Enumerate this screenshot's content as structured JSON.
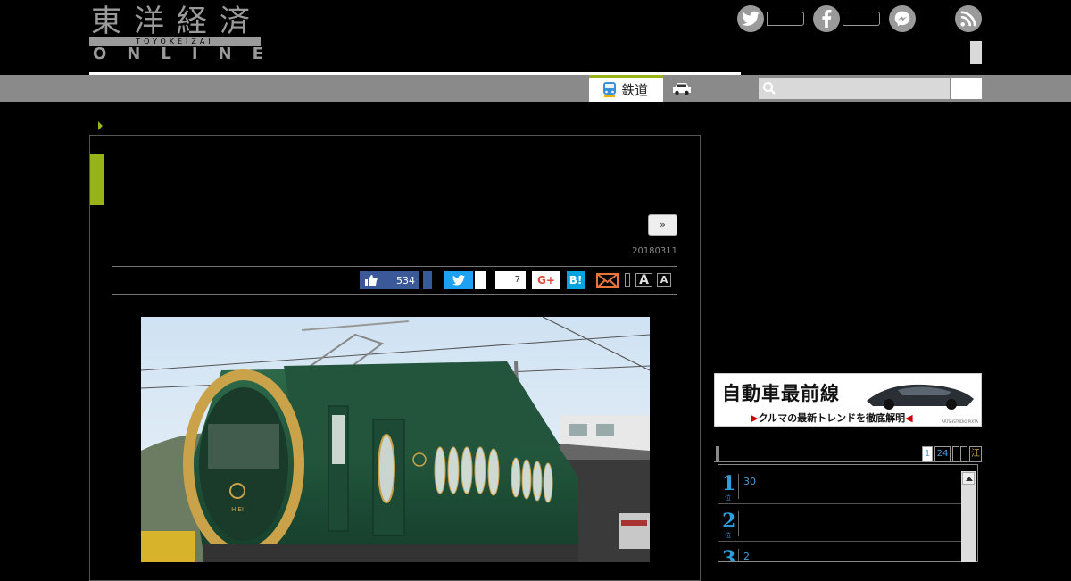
{
  "header": {
    "logo_kanji": "東洋経済",
    "logo_sub": "TOYOKEIZAI",
    "logo_online": "ONLINE",
    "social": [
      "twitter-icon",
      "facebook-icon",
      "messenger-icon",
      "rss-icon"
    ]
  },
  "nav": {
    "active_tab": "鉄道",
    "search": {
      "placeholder": ""
    }
  },
  "article": {
    "next_label": "»",
    "date": "20180311",
    "share": {
      "facebook_count": "534",
      "pocket_count": "7",
      "google_plus_label": "G+",
      "hatena_label": "B!"
    },
    "font_buttons": [
      "A",
      "A"
    ]
  },
  "sidebar": {
    "banner": {
      "title": "自動車最前線",
      "subtitle": "クルマの最新トレンドを徹底解明",
      "credit": "ARTSHSTUDIO PIXTA"
    },
    "ranking": {
      "tabs": [
        "1",
        "24",
        "",
        "",
        "江"
      ],
      "items": [
        {
          "rank": "1",
          "unit": "位",
          "text": "30"
        },
        {
          "rank": "2",
          "unit": "位",
          "text": ""
        },
        {
          "rank": "3",
          "unit": "位",
          "text": "2"
        }
      ]
    }
  },
  "colors": {
    "accent": "#96b318",
    "navbar": "#8a8a8a",
    "rank_blue": "#2d9fdd",
    "facebook": "#3b5998",
    "twitter": "#1da1f2",
    "hatena": "#00a4de",
    "train_green": "#1f5a3e",
    "train_gold": "#c9a24a"
  }
}
